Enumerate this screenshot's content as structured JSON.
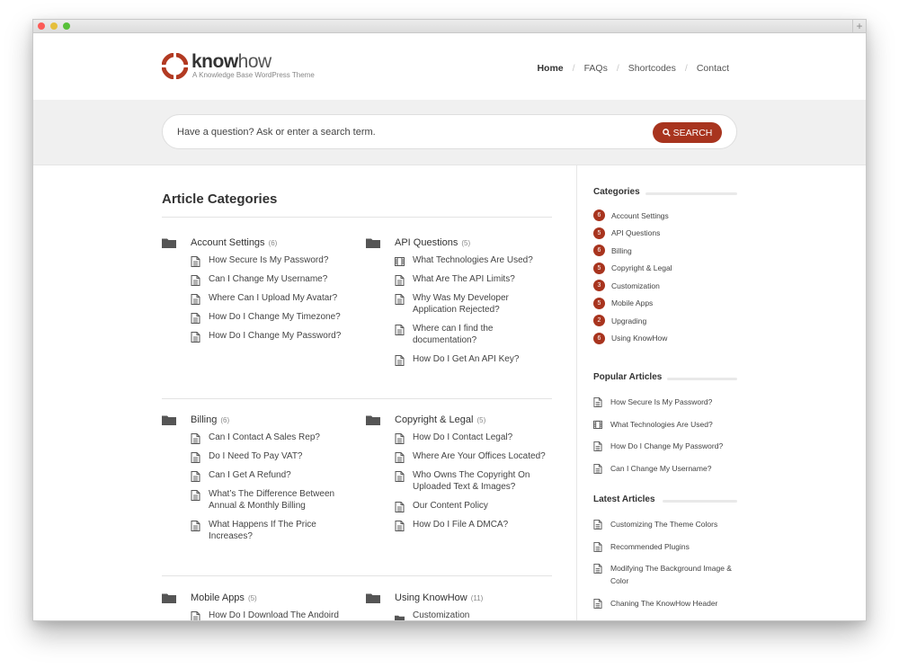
{
  "brand": {
    "name_bold": "know",
    "name_light": "how",
    "tagline": "A Knowledge Base WordPress Theme",
    "accent_color": "#a8341e"
  },
  "nav": {
    "items": [
      {
        "label": "Home",
        "active": true
      },
      {
        "label": "FAQs",
        "active": false
      },
      {
        "label": "Shortcodes",
        "active": false
      },
      {
        "label": "Contact",
        "active": false
      }
    ],
    "separator": "/"
  },
  "search": {
    "placeholder": "Have a question? Ask or enter a search term.",
    "button_label": "SEARCH",
    "button_icon": "search-icon"
  },
  "main": {
    "title": "Article Categories",
    "categories": [
      {
        "name": "Account Settings",
        "count": "(6)",
        "articles": [
          {
            "title": "How Secure Is My Password?",
            "icon": "document-icon"
          },
          {
            "title": "Can I Change My Username?",
            "icon": "document-icon"
          },
          {
            "title": "Where Can I Upload My Avatar?",
            "icon": "document-icon"
          },
          {
            "title": "How Do I Change My Timezone?",
            "icon": "document-icon"
          },
          {
            "title": "How Do I Change My Password?",
            "icon": "document-icon"
          }
        ]
      },
      {
        "name": "API Questions",
        "count": "(5)",
        "articles": [
          {
            "title": "What Technologies Are Used?",
            "icon": "film-icon"
          },
          {
            "title": "What Are The API Limits?",
            "icon": "document-icon"
          },
          {
            "title": "Why Was My Developer Application Rejected?",
            "icon": "document-icon"
          },
          {
            "title": "Where can I find the documentation?",
            "icon": "document-icon"
          },
          {
            "title": "How Do I Get An API Key?",
            "icon": "document-icon"
          }
        ]
      },
      {
        "name": "Billing",
        "count": "(6)",
        "articles": [
          {
            "title": "Can I Contact A Sales Rep?",
            "icon": "document-icon"
          },
          {
            "title": "Do I Need To Pay VAT?",
            "icon": "document-icon"
          },
          {
            "title": "Can I Get A Refund?",
            "icon": "document-icon"
          },
          {
            "title": "What’s The Difference Between Annual & Monthly Billing",
            "icon": "document-icon"
          },
          {
            "title": "What Happens If The Price Increases?",
            "icon": "document-icon"
          }
        ]
      },
      {
        "name": "Copyright & Legal",
        "count": "(5)",
        "articles": [
          {
            "title": "How Do I Contact Legal?",
            "icon": "document-icon"
          },
          {
            "title": "Where Are Your Offices Located?",
            "icon": "document-icon"
          },
          {
            "title": "Who Owns The Copyright On Uploaded Text & Images?",
            "icon": "document-icon"
          },
          {
            "title": "Our Content Policy",
            "icon": "document-icon"
          },
          {
            "title": "How Do I File A DMCA?",
            "icon": "document-icon"
          }
        ]
      },
      {
        "name": "Mobile Apps",
        "count": "(5)",
        "articles": [
          {
            "title": "How Do I Download The Andoird App?",
            "icon": "document-icon"
          }
        ]
      },
      {
        "name": "Using KnowHow",
        "count": "(11)",
        "articles": [
          {
            "title": "Customization",
            "icon": "folder-icon"
          }
        ]
      }
    ]
  },
  "sidebar": {
    "categories": {
      "title": "Categories",
      "items": [
        {
          "count": "6",
          "name": "Account Settings"
        },
        {
          "count": "5",
          "name": "API Questions"
        },
        {
          "count": "6",
          "name": "Billing"
        },
        {
          "count": "5",
          "name": "Copyright & Legal"
        },
        {
          "count": "3",
          "name": "Customization"
        },
        {
          "count": "5",
          "name": "Mobile Apps"
        },
        {
          "count": "2",
          "name": "Upgrading"
        },
        {
          "count": "6",
          "name": "Using KnowHow"
        }
      ]
    },
    "popular": {
      "title": "Popular Articles",
      "items": [
        {
          "title": "How Secure Is My Password?",
          "icon": "document-icon"
        },
        {
          "title": "What Technologies Are Used?",
          "icon": "film-icon"
        },
        {
          "title": "How Do I Change My Password?",
          "icon": "document-icon"
        },
        {
          "title": "Can I Change My Username?",
          "icon": "document-icon"
        }
      ]
    },
    "latest": {
      "title": "Latest Articles",
      "items": [
        {
          "title": "Customizing The Theme Colors",
          "icon": "document-icon"
        },
        {
          "title": "Recommended Plugins",
          "icon": "document-icon"
        },
        {
          "title": "Modifying The Background Image & Color",
          "icon": "document-icon"
        },
        {
          "title": "Chaning The KnowHow Header",
          "icon": "document-icon"
        }
      ]
    }
  }
}
